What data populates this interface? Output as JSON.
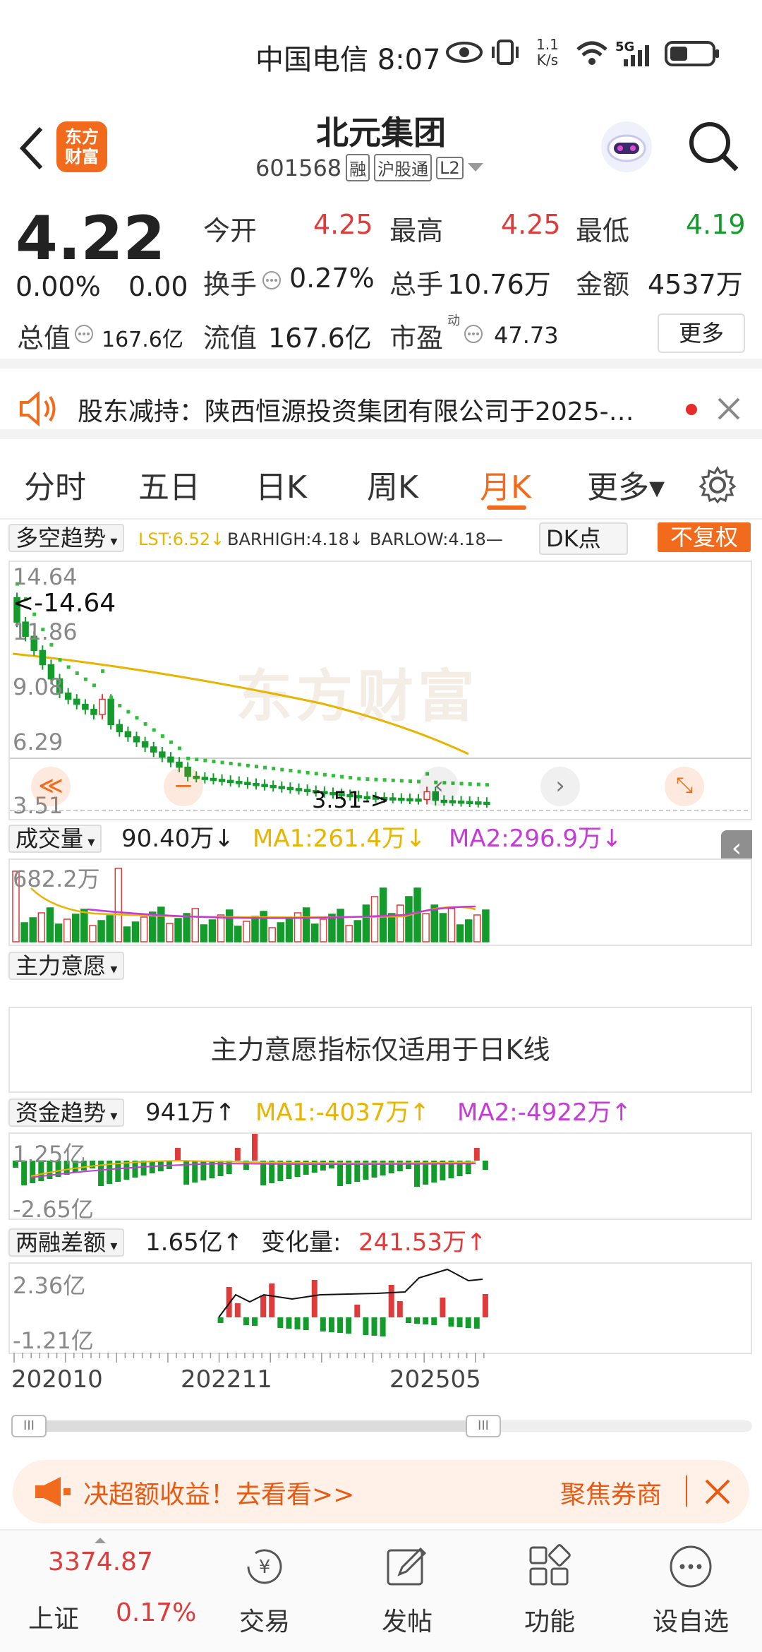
{
  "status_bar": {
    "carrier_time": "中国电信 8:07",
    "speed_top": "1.1",
    "speed_unit": "K/s",
    "network": "5G"
  },
  "header": {
    "stock_name": "北元集团",
    "stock_code": "601568",
    "tags": [
      "融",
      "沪股通",
      "L2"
    ],
    "logo_line1": "东方",
    "logo_line2": "财富"
  },
  "quote": {
    "price": "4.22",
    "change_pct": "0.00%",
    "change": "0.00",
    "open_label": "今开",
    "open": "4.25",
    "high_label": "最高",
    "high": "4.25",
    "low_label": "最低",
    "low": "4.19",
    "turnover_label": "换手",
    "turnover": "0.27%",
    "volume_label": "总手",
    "volume": "10.76万",
    "amount_label": "金额",
    "amount": "4537万",
    "mktcap_label": "总值",
    "mktcap": "167.6亿",
    "float_label": "流值",
    "float": "167.6亿",
    "pe_label": "市盈",
    "pe_sup": "动",
    "pe": "47.73",
    "more": "更多"
  },
  "notice": {
    "text": "股东减持：陕西恒源投资集团有限公司于2025-…"
  },
  "tabs": [
    "分时",
    "五日",
    "日K",
    "周K",
    "月K",
    "更多▾"
  ],
  "active_tab": 4,
  "kline": {
    "indicator": "多空趋势",
    "lst": "LST:6.52↓",
    "barhigh": "BARHIGH:4.18↓",
    "barlow": "BARLOW:4.18—",
    "dk": "DK点",
    "fuquan": "不复权",
    "y_labels": [
      "14.64",
      "11.86",
      "9.08",
      "6.29",
      "3.51"
    ],
    "max_label": "<-14.64",
    "min_label": "3.51->",
    "watermark": "东方财富"
  },
  "volume": {
    "label": "成交量",
    "value": "90.40万↓",
    "ma1": "MA1:261.4万↓",
    "ma2": "MA2:296.9万↓",
    "max": "682.2万"
  },
  "zhuli": {
    "label": "主力意愿",
    "message": "主力意愿指标仅适用于日K线"
  },
  "zijin": {
    "label": "资金趋势",
    "value": "941万↑",
    "ma1": "MA1:-4037万↑",
    "ma2": "MA2:-4922万↑",
    "top": "1.25亿",
    "bottom": "-2.65亿"
  },
  "rongzi": {
    "label": "两融差额",
    "value": "1.65亿↑",
    "change_label": "变化量:",
    "change": "241.53万↑",
    "top": "2.36亿",
    "bottom": "-1.21亿"
  },
  "x_axis": [
    "202010",
    "202211",
    "202505"
  ],
  "banner": {
    "text": "决超额收益！去看看>>",
    "right": "聚焦券商"
  },
  "bottom_nav": {
    "index_value": "3374.87",
    "index_name": "上证",
    "index_change": "0.17%",
    "items": [
      "交易",
      "发帖",
      "功能",
      "设自选"
    ]
  },
  "colors": {
    "up": "#e03a3a",
    "down": "#139c2c",
    "accent": "#f26b1d"
  }
}
